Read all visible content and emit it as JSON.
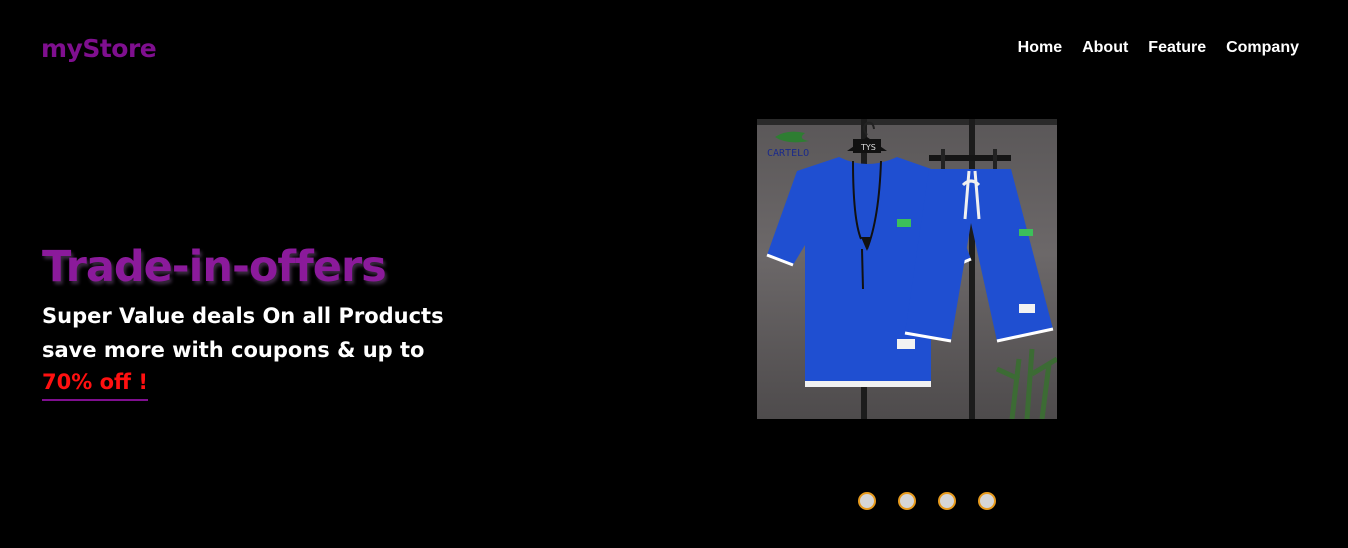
{
  "header": {
    "logo": "myStore",
    "nav": [
      {
        "label": "Home"
      },
      {
        "label": "About"
      },
      {
        "label": "Feature"
      },
      {
        "label": "Company"
      }
    ]
  },
  "hero": {
    "title": "Trade-in-offers",
    "subtitle_line1": "Super Value deals On all Products",
    "subtitle_line2": "save more with coupons & up to",
    "offer": "70% off !"
  },
  "product_image": {
    "brand_label": "CARTELO",
    "hanger_tag": "TYS",
    "alt": "Blue t-shirt and shorts set"
  },
  "carousel": {
    "dot_count": 4,
    "dot_fill": "#d6d6d6",
    "dot_border": "#e89b1e"
  },
  "colors": {
    "background": "#000000",
    "brand": "#7f0f8f",
    "offer": "#ff1010",
    "garment": "#1f4fd1"
  }
}
